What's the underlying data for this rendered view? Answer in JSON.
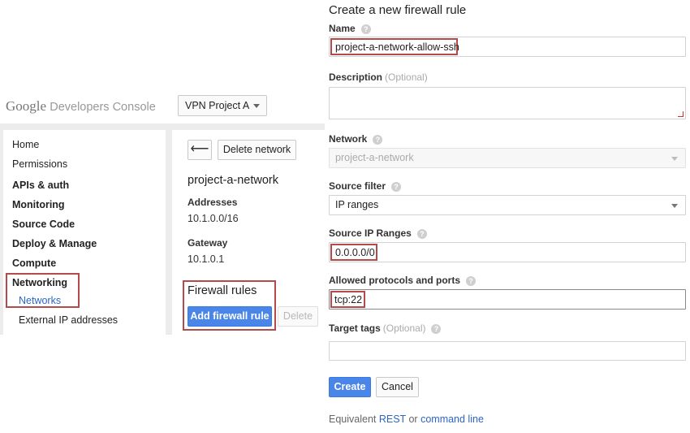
{
  "header": {
    "logo_google": "Google",
    "logo_product": "Developers Console",
    "project": "VPN Project A"
  },
  "sidebar": {
    "items": [
      {
        "label": "Home"
      },
      {
        "label": "Permissions"
      },
      {
        "label": "APIs & auth"
      },
      {
        "label": "Monitoring"
      },
      {
        "label": "Source Code"
      },
      {
        "label": "Deploy & Manage"
      },
      {
        "label": "Compute"
      },
      {
        "label": "Networking"
      },
      {
        "label": "Networks"
      },
      {
        "label": "External IP addresses"
      }
    ]
  },
  "detail": {
    "back_glyph": "⟵",
    "delete_network_label": "Delete network",
    "network_name": "project-a-network",
    "addresses_label": "Addresses",
    "addresses_value": "10.1.0.0/16",
    "gateway_label": "Gateway",
    "gateway_value": "10.1.0.1",
    "firewall_title": "Firewall rules",
    "add_firewall_label": "Add firewall rule",
    "delete_label": "Delete"
  },
  "form": {
    "title": "Create a new firewall rule",
    "name_label": "Name",
    "name_value": "project-a-network-allow-ssh",
    "description_label": "Description",
    "optional_label": "(Optional)",
    "network_label": "Network",
    "network_value": "project-a-network",
    "source_filter_label": "Source filter",
    "source_filter_value": "IP ranges",
    "source_ip_label": "Source IP Ranges",
    "source_ip_value": "0.0.0.0/0",
    "protocols_label": "Allowed protocols and ports",
    "protocols_value": "tcp:22",
    "target_tags_label": "Target tags",
    "help_glyph": "?",
    "create_label": "Create",
    "cancel_label": "Cancel",
    "equivalent_text": "Equivalent",
    "rest_link": "REST",
    "or_text": "or",
    "command_line_link": "command line"
  },
  "colors": {
    "primary_button": "#4a86e8",
    "link": "#2b65c9",
    "highlight_border": "#b54a4a"
  }
}
